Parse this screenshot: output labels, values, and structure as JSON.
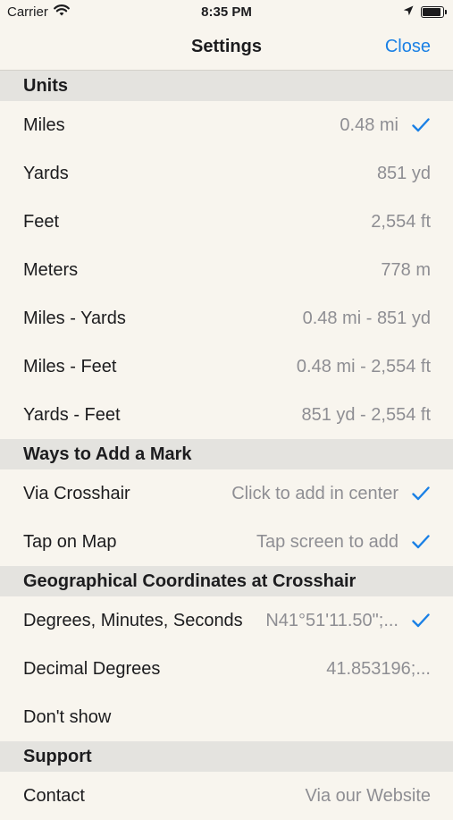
{
  "status_bar": {
    "carrier": "Carrier",
    "time": "8:35 PM"
  },
  "nav": {
    "title": "Settings",
    "close_label": "Close"
  },
  "colors": {
    "accent": "#1a80e5",
    "background": "#f8f5ee",
    "section_header": "#e4e3df",
    "secondary_text": "#8e8e93"
  },
  "sections": {
    "units": {
      "header": "Units",
      "rows": [
        {
          "label": "Miles",
          "value": "0.48 mi",
          "checked": true
        },
        {
          "label": "Yards",
          "value": "851 yd",
          "checked": false
        },
        {
          "label": "Feet",
          "value": "2,554 ft",
          "checked": false
        },
        {
          "label": "Meters",
          "value": "778 m",
          "checked": false
        },
        {
          "label": "Miles - Yards",
          "value": "0.48 mi - 851 yd",
          "checked": false
        },
        {
          "label": "Miles - Feet",
          "value": "0.48 mi - 2,554 ft",
          "checked": false
        },
        {
          "label": "Yards - Feet",
          "value": "851 yd - 2,554 ft",
          "checked": false
        }
      ]
    },
    "add_mark": {
      "header": "Ways to Add a Mark",
      "rows": [
        {
          "label": "Via Crosshair",
          "value": "Click to add in center",
          "checked": true
        },
        {
          "label": "Tap on Map",
          "value": "Tap screen to add",
          "checked": true
        }
      ]
    },
    "coordinates": {
      "header": "Geographical Coordinates at Crosshair",
      "rows": [
        {
          "label": "Degrees, Minutes, Seconds",
          "value": "N41°51'11.50\";...",
          "checked": true
        },
        {
          "label": "Decimal Degrees",
          "value": "41.853196;...",
          "checked": false
        },
        {
          "label": "Don't show",
          "value": "",
          "checked": false
        }
      ]
    },
    "support": {
      "header": "Support",
      "rows": [
        {
          "label": "Contact",
          "value": "Via our Website",
          "checked": false
        }
      ]
    }
  }
}
